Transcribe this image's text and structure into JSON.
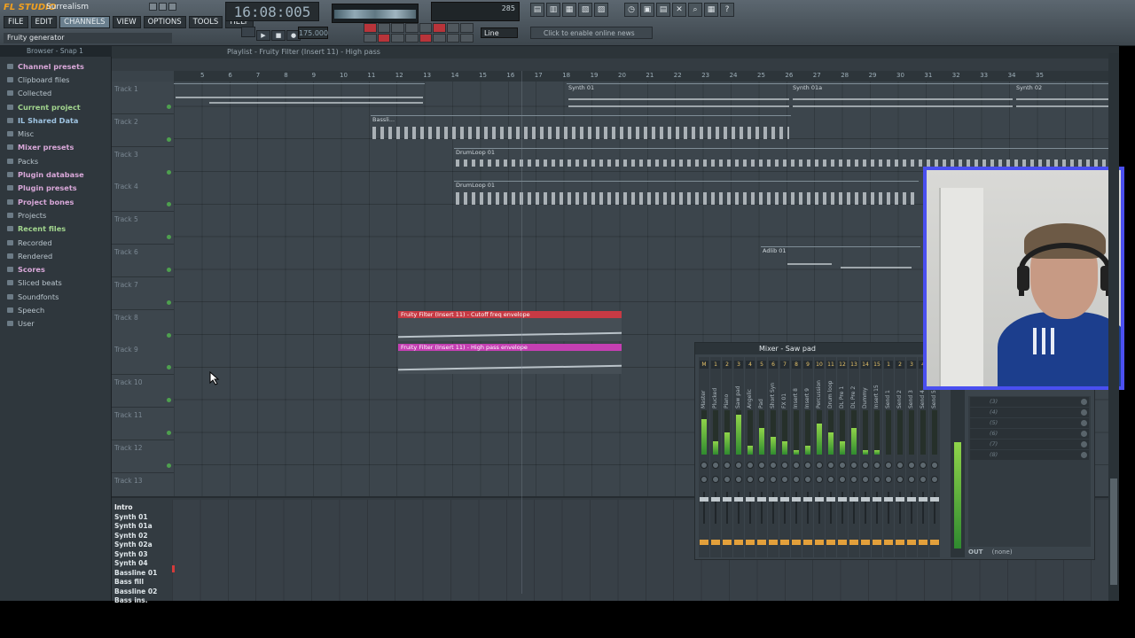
{
  "app": {
    "logo": "FL STUDIO",
    "project": "Surrealism",
    "menu": [
      "FILE",
      "EDIT",
      "CHANNELS",
      "VIEW",
      "OPTIONS",
      "TOOLS",
      "HELP"
    ],
    "active_menu": "CHANNELS",
    "hint": "Fruity generator",
    "time": "16:08:005",
    "tempo": "175.000",
    "cpu_label": "285",
    "line_mode": "Line",
    "news": "Click to enable online news"
  },
  "browser": {
    "title": "Browser - Snap 1",
    "items": [
      {
        "label": "Channel presets",
        "style": "hi"
      },
      {
        "label": "Clipboard files",
        "style": ""
      },
      {
        "label": "Collected",
        "style": ""
      },
      {
        "label": "Current project",
        "style": "hi2"
      },
      {
        "label": "IL Shared Data",
        "style": "blu"
      },
      {
        "label": "Misc",
        "style": ""
      },
      {
        "label": "Mixer presets",
        "style": "hi"
      },
      {
        "label": "Packs",
        "style": ""
      },
      {
        "label": "Plugin database",
        "style": "hi"
      },
      {
        "label": "Plugin presets",
        "style": "hi"
      },
      {
        "label": "Project bones",
        "style": "hi"
      },
      {
        "label": "Projects",
        "style": ""
      },
      {
        "label": "Recent files",
        "style": "hi2"
      },
      {
        "label": "Recorded",
        "style": ""
      },
      {
        "label": "Rendered",
        "style": ""
      },
      {
        "label": "Scores",
        "style": "hi"
      },
      {
        "label": "Sliced beats",
        "style": ""
      },
      {
        "label": "Soundfonts",
        "style": ""
      },
      {
        "label": "Speech",
        "style": ""
      },
      {
        "label": "User",
        "style": ""
      }
    ]
  },
  "playlist": {
    "title": "Playlist - Fruity Filter (Insert 11) - High pass",
    "ruler": [
      "5",
      "6",
      "7",
      "8",
      "9",
      "10",
      "11",
      "12",
      "13",
      "14",
      "15",
      "16",
      "17",
      "18",
      "19",
      "20",
      "21",
      "22",
      "23",
      "24",
      "25",
      "26",
      "27",
      "28",
      "29",
      "30",
      "31",
      "32",
      "33",
      "34",
      "35"
    ],
    "tracks": [
      "Track 1",
      "Track 2",
      "Track 3",
      "Track 4",
      "Track 5",
      "Track 6",
      "Track 7",
      "Track 8",
      "Track 9",
      "Track 10",
      "Track 11",
      "Track 12",
      "Track 13"
    ],
    "clips": {
      "synth01": "Synth 01",
      "synth01a": "Synth 01a",
      "synth02": "Synth 02",
      "bassline": "Bassli...",
      "drumloop": "DrumLoop 01",
      "adlib": "Adlib 01",
      "env_cutoff": "Fruity Filter (Insert 11) - Cutoff freq envelope",
      "env_highpass": "Fruity Filter (Insert 11) - High pass envelope"
    }
  },
  "patterns": [
    "Intro",
    "Synth 01",
    "Synth 01a",
    "Synth 02",
    "Synth 02a",
    "Synth 03",
    "Synth 04",
    "Bassline 01",
    "Bass fill",
    "Bassline 02",
    "Bass ins."
  ],
  "mixer": {
    "title": "Mixer - Saw pad",
    "strips": [
      {
        "num": "M",
        "name": "Master"
      },
      {
        "num": "1",
        "name": "Plucked"
      },
      {
        "num": "2",
        "name": "Piano"
      },
      {
        "num": "3",
        "name": "Saw pad"
      },
      {
        "num": "4",
        "name": "Angelic"
      },
      {
        "num": "5",
        "name": "Pad"
      },
      {
        "num": "6",
        "name": "Short Syn"
      },
      {
        "num": "7",
        "name": "FX 01"
      },
      {
        "num": "8",
        "name": "Insert 8"
      },
      {
        "num": "9",
        "name": "Insert 9"
      },
      {
        "num": "10",
        "name": "Percussion"
      },
      {
        "num": "11",
        "name": "Drum loop"
      },
      {
        "num": "12",
        "name": "DL Pre 1"
      },
      {
        "num": "13",
        "name": "DL Pre 2"
      },
      {
        "num": "14",
        "name": "Dummy"
      },
      {
        "num": "15",
        "name": "Insert 15"
      },
      {
        "num": "1",
        "name": "Send 1"
      },
      {
        "num": "2",
        "name": "Send 2"
      },
      {
        "num": "3",
        "name": "Send 3"
      },
      {
        "num": "4",
        "name": "Send 4"
      },
      {
        "num": "5",
        "name": "Send 5"
      }
    ],
    "fx_slots": [
      "(3)",
      "(4)",
      "(5)",
      "(6)",
      "(7)",
      "(8)"
    ],
    "out_label": "OUT",
    "out_value": "(none)"
  }
}
